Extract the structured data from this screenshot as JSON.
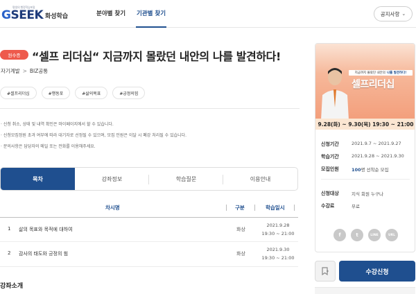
{
  "header": {
    "logo_small": "평생의 행정학습포털",
    "logo_text_g": "G",
    "logo_text_rest": "SEEK",
    "logo_sub": "화성학습",
    "nav": [
      "분야별 찾기",
      "기관별 찾기"
    ],
    "notice_label": "공지사항",
    "notice_icon": "chevron-down-icon"
  },
  "course": {
    "badge": "원수증",
    "title": "“셀프 리더십“ 지금까지 몰랐던 내안의 나를 발견하다!",
    "breadcrumb": [
      "자기계발",
      "BIZ공통"
    ],
    "breadcrumb_sep": ">",
    "tags": [
      "#셀프리더십",
      "#행동포",
      "#삶의목표",
      "#긍정의힘"
    ],
    "notes": [
      "· 신청 취소, 상태 및 내역 확인은 마이페이지에서 할 수 있습니다.",
      "· 신청모집정원 초과 여부에 따라 대기자로 선정될 수 있으며, 모집 인원은 이달 시 폐강 처리될 수 있습니다.",
      "· 문의사항은 담당자의 메일 또는 전화를 이용해주세요."
    ]
  },
  "tabs": [
    "목차",
    "강좌정보",
    "학습질문",
    "이용안내"
  ],
  "table": {
    "headers": [
      "차시명",
      "구분",
      "학습일시"
    ],
    "rows": [
      {
        "num": "1",
        "title": "삶의 목표와 목적에 대하여",
        "type": "화상",
        "date": "2021.9.28",
        "time": "19:30 ~ 21:00"
      },
      {
        "num": "2",
        "title": "감사의 태도와 긍정의 힘",
        "type": "화상",
        "date": "2021.9.30",
        "time": "19:30 ~ 21:00"
      }
    ]
  },
  "section_title": "강좌소개",
  "side": {
    "banner_ribbon_text": "지금까지 몰랐던 내안의",
    "banner_ribbon_bold": "나를 발견하다!",
    "banner_title": "셀프리더십",
    "date_bar": "9.28(화) ~ 9.30(목) 19:30 ~ 21:00",
    "info": [
      {
        "label": "신청기간",
        "value": "2021.9.7 ~ 2021.9.27"
      },
      {
        "label": "학습기간",
        "value": "2021.9.28 ~ 2021.9.30"
      },
      {
        "label": "모집인원",
        "value_hl": "100",
        "value": "명 선착순 모집"
      },
      {
        "label": "신청대상",
        "value": "지식 회원 누구나"
      },
      {
        "label": "수강료",
        "value": "무료"
      }
    ],
    "share": [
      {
        "icon": "facebook-icon",
        "glyph": "f"
      },
      {
        "icon": "twitter-icon",
        "glyph": "t"
      },
      {
        "icon": "line-icon",
        "glyph": "LINE"
      },
      {
        "icon": "url-icon",
        "glyph": "URL"
      }
    ],
    "wish_icon": "bookmark-icon",
    "enroll_label": "수강신청"
  },
  "colors": {
    "primary": "#1f4f8f",
    "badge": "#ee5a4c",
    "date_bar": "#fbe6d2"
  }
}
